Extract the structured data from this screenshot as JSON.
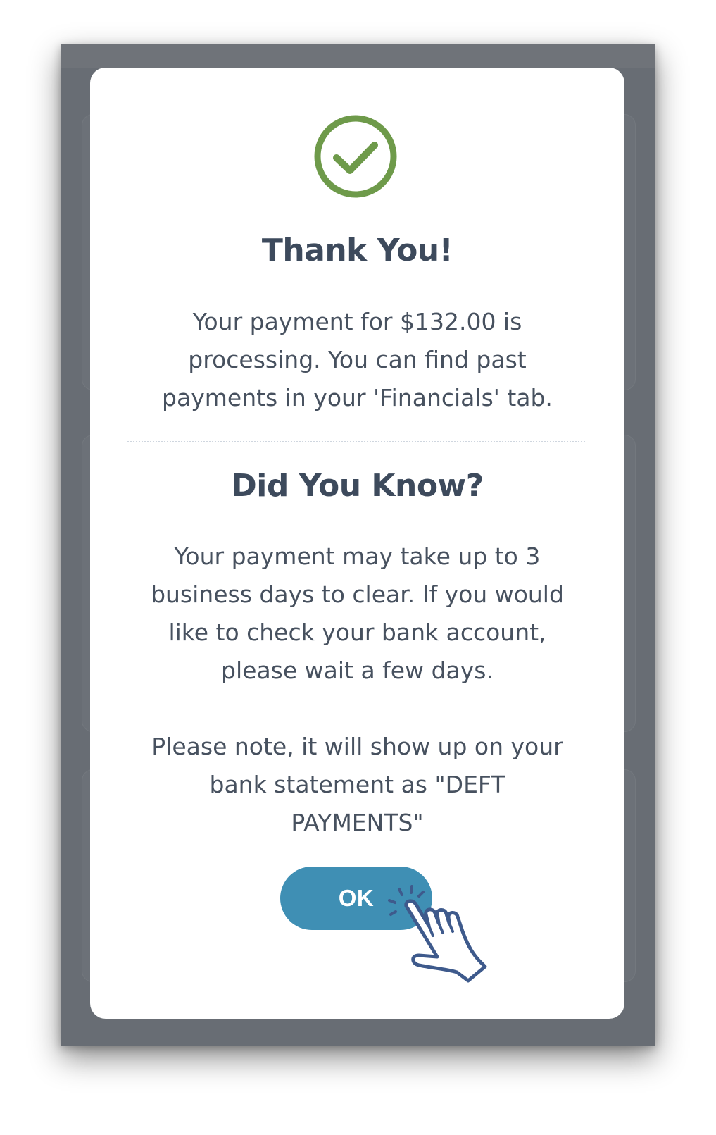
{
  "modal": {
    "title": "Thank You!",
    "message": "Your payment for $132.00 is processing. You can find past payments in your 'Financials' tab.",
    "info_title": "Did You Know?",
    "info_body": "Your payment may take up to 3 business days to clear. If you would like to check your bank account, please wait a few days.",
    "note": "Please note, it will show up on your bank statement as \"DEFT PAYMENTS\"",
    "ok_label": "OK"
  },
  "icons": {
    "success": "check-circle-icon",
    "pointer": "hand-pointer-icon"
  },
  "colors": {
    "success_green": "#6e9a4a",
    "button_blue": "#3f8fb4",
    "heading_text": "#3d4a5c",
    "body_text": "#47515f",
    "overlay": "#686d74",
    "hand_outline": "#3e5a8c"
  }
}
